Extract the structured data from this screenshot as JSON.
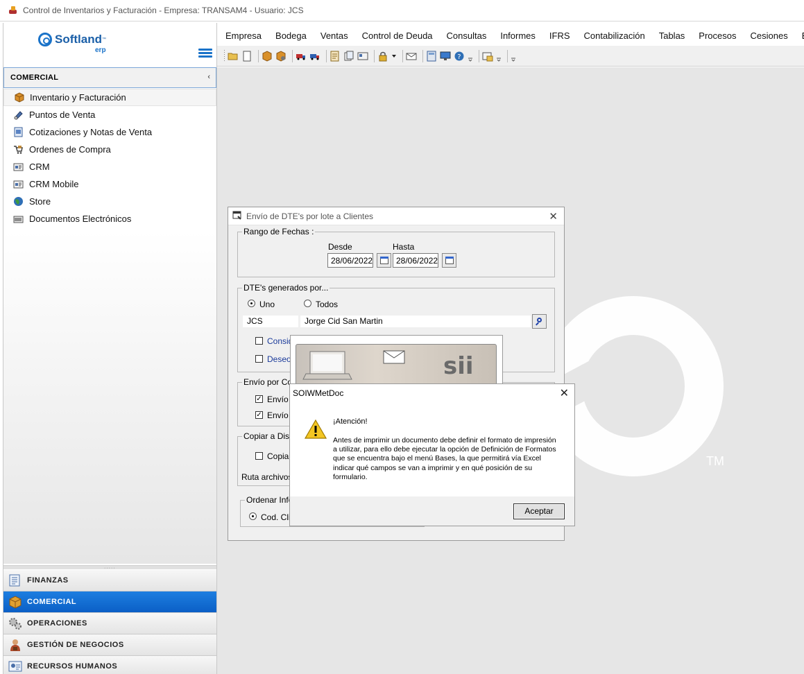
{
  "window": {
    "title": "Control de Inventarios y Facturación - Empresa: TRANSAM4 - Usuario: JCS"
  },
  "sidebar": {
    "logo": {
      "brand": "Softland",
      "suffix": "erp",
      "tm": "™"
    },
    "module_header": "COMERCIAL",
    "collapse_glyph": "‹",
    "items": [
      {
        "label": "Inventario y Facturación",
        "icon": "box-icon"
      },
      {
        "label": "Puntos de Venta",
        "icon": "pos-icon"
      },
      {
        "label": "Cotizaciones y Notas de Venta",
        "icon": "notes-icon"
      },
      {
        "label": "Ordenes de Compra",
        "icon": "cart-icon"
      },
      {
        "label": "CRM",
        "icon": "crm-icon"
      },
      {
        "label": "CRM Mobile",
        "icon": "crm-mobile-icon"
      },
      {
        "label": "Store",
        "icon": "globe-icon"
      },
      {
        "label": "Documentos Electrónicos",
        "icon": "edoc-icon"
      }
    ],
    "splitter_grip": "·····",
    "bottom_modules": [
      {
        "label": "FINANZAS",
        "icon": "finance-icon"
      },
      {
        "label": "COMERCIAL",
        "icon": "commercial-icon",
        "active": true
      },
      {
        "label": "OPERACIONES",
        "icon": "gears-icon"
      },
      {
        "label": "GESTIÓN DE NEGOCIOS",
        "icon": "business-icon"
      },
      {
        "label": "RECURSOS HUMANOS",
        "icon": "hr-icon"
      }
    ]
  },
  "menubar": {
    "items": [
      "Empresa",
      "Bodega",
      "Ventas",
      "Control de Deuda",
      "Consultas",
      "Informes",
      "IFRS",
      "Contabilización",
      "Tablas",
      "Procesos",
      "Cesiones",
      "E"
    ]
  },
  "workspace": {
    "watermark_tm": "TM"
  },
  "envio_dialog": {
    "title": "Envío de DTE's por lote a Clientes",
    "close_glyph": "✕",
    "rango": {
      "caption": "Rango de Fechas :",
      "desde_label": "Desde",
      "hasta_label": "Hasta",
      "desde_value": "28/06/2022",
      "hasta_value": "28/06/2022"
    },
    "generados": {
      "caption": "DTE's generados por...",
      "uno_label": "Uno",
      "todos_label": "Todos",
      "selected": "Uno",
      "user_code": "JCS",
      "user_name": "Jorge Cid San Martin",
      "chk1_label": "Consid",
      "chk2_label": "Deseo"
    },
    "envio_por": {
      "caption": "Envío por Cor",
      "chk1_label": "Envío :",
      "chk2_label": "Envío",
      "chk_mark": "✓"
    },
    "copiar": {
      "caption": "Copiar a Disco",
      "chk_label": "Copiar",
      "ruta_label": "Ruta archivos"
    },
    "ordenar": {
      "caption": "Ordenar Infor",
      "radio_label": "Cod. Clie"
    }
  },
  "splash": {
    "sii_text": "sii"
  },
  "alert_dialog": {
    "title": "SOIWMetDoc",
    "close_glyph": "✕",
    "heading": "¡Atención!",
    "message": "Antes de imprimir un documento debe definir el formato de impresión a utilizar, para ello debe ejecutar la opción de Definición de Formatos que se encuentra bajo el menú Bases, la que permitirá vía Excel indicar qué campos se van a imprimir y en qué posición de su formulario.",
    "ok_label": "Aceptar"
  }
}
